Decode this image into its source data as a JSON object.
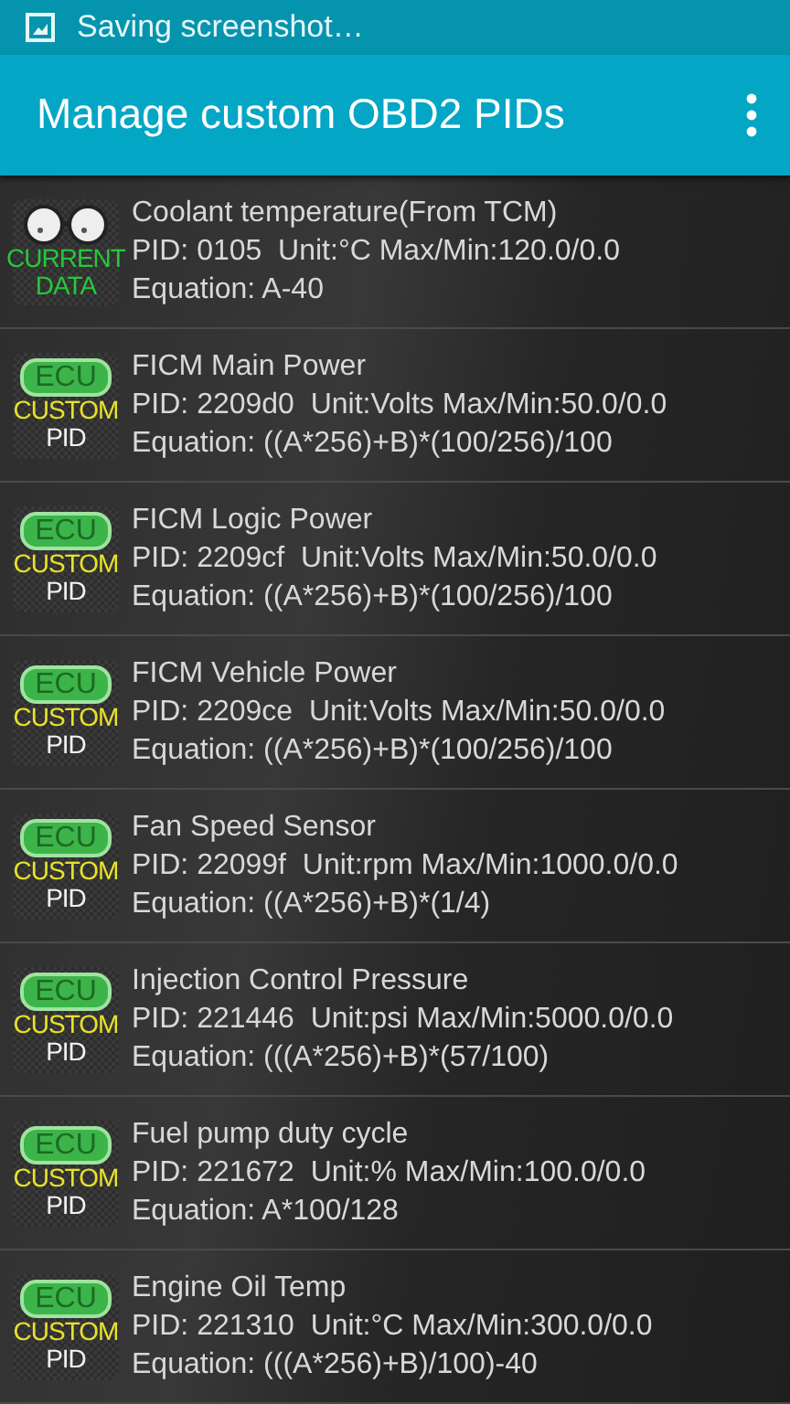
{
  "status_bar": {
    "notification": "Saving screenshot…"
  },
  "app_bar": {
    "title": "Manage custom OBD2 PIDs"
  },
  "pids": [
    {
      "kind": "current_data",
      "badge": [
        "CURRENT",
        "DATA"
      ],
      "name": "Coolant temperature(From TCM)",
      "details": "PID: 0105  Unit:°C Max/Min:120.0/0.0",
      "equation": "Equation: A-40"
    },
    {
      "kind": "custom_pid",
      "badge": [
        "ECU",
        "CUSTOM",
        "PID"
      ],
      "name": "FICM Main Power",
      "details": "PID: 2209d0  Unit:Volts Max/Min:50.0/0.0",
      "equation": "Equation: ((A*256)+B)*(100/256)/100"
    },
    {
      "kind": "custom_pid",
      "badge": [
        "ECU",
        "CUSTOM",
        "PID"
      ],
      "name": "FICM Logic Power",
      "details": "PID: 2209cf  Unit:Volts Max/Min:50.0/0.0",
      "equation": "Equation: ((A*256)+B)*(100/256)/100"
    },
    {
      "kind": "custom_pid",
      "badge": [
        "ECU",
        "CUSTOM",
        "PID"
      ],
      "name": "FICM Vehicle Power",
      "details": "PID: 2209ce  Unit:Volts Max/Min:50.0/0.0",
      "equation": "Equation: ((A*256)+B)*(100/256)/100"
    },
    {
      "kind": "custom_pid",
      "badge": [
        "ECU",
        "CUSTOM",
        "PID"
      ],
      "name": "Fan Speed Sensor",
      "details": "PID: 22099f  Unit:rpm Max/Min:1000.0/0.0",
      "equation": "Equation: ((A*256)+B)*(1/4)"
    },
    {
      "kind": "custom_pid",
      "badge": [
        "ECU",
        "CUSTOM",
        "PID"
      ],
      "name": "Injection Control Pressure",
      "details": "PID: 221446  Unit:psi Max/Min:5000.0/0.0",
      "equation": "Equation: (((A*256)+B)*(57/100)"
    },
    {
      "kind": "custom_pid",
      "badge": [
        "ECU",
        "CUSTOM",
        "PID"
      ],
      "name": "Fuel pump duty cycle",
      "details": "PID: 221672  Unit:% Max/Min:100.0/0.0",
      "equation": "Equation: A*100/128"
    },
    {
      "kind": "custom_pid",
      "badge": [
        "ECU",
        "CUSTOM",
        "PID"
      ],
      "name": "Engine Oil Temp",
      "details": "PID: 221310  Unit:°C Max/Min:300.0/0.0",
      "equation": "Equation: (((A*256)+B)/100)-40"
    }
  ]
}
